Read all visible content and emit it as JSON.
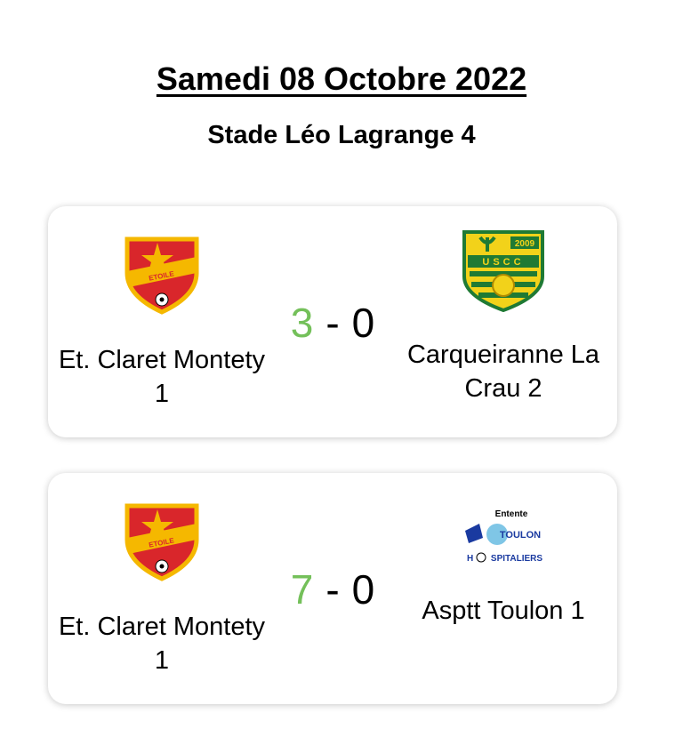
{
  "header": {
    "date": "Samedi 08 Octobre 2022",
    "stadium": "Stade Léo Lagrange 4"
  },
  "matches": [
    {
      "home": {
        "name": "Et. Claret Montety 1",
        "logo": "etoile-claret-montety-crest"
      },
      "away": {
        "name": "Carqueiranne La Crau 2",
        "logo": "uscc-crest",
        "logo_text": "USCC",
        "logo_year": "2009"
      },
      "score": {
        "home": "3",
        "separator": "-",
        "away": "0"
      },
      "winner_color": "#74c05a"
    },
    {
      "home": {
        "name": "Et. Claret Montety 1",
        "logo": "etoile-claret-montety-crest"
      },
      "away": {
        "name": "Asptt Toulon 1",
        "logo": "entente-asptt-toulon-logo",
        "logo_text": "Entente",
        "logo_sub": "TOULON",
        "logo_bottom": "SPITALIERS"
      },
      "score": {
        "home": "7",
        "separator": "-",
        "away": "0"
      },
      "winner_color": "#74c05a"
    }
  ],
  "colors": {
    "home_crest_red": "#d9262b",
    "home_crest_yellow": "#f5b800",
    "uscc_green": "#1f7a34",
    "uscc_yellow": "#f2d21a",
    "asptt_blue": "#1a3aa0"
  }
}
